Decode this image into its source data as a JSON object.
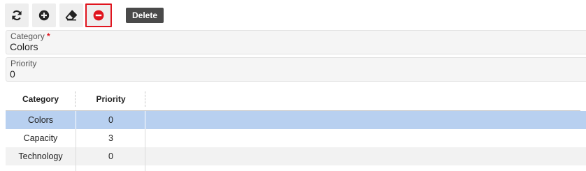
{
  "toolbar": {
    "buttons": [
      {
        "icon": "refresh-icon",
        "label": "Refresh"
      },
      {
        "icon": "add-circle-icon",
        "label": "Add"
      },
      {
        "icon": "eraser-icon",
        "label": "Clear"
      },
      {
        "icon": "remove-circle-icon",
        "label": "Delete"
      }
    ],
    "tooltip": "Delete",
    "delete_color": "#e0141e"
  },
  "form": {
    "category": {
      "label": "Category",
      "required_mark": "*",
      "value": "Colors"
    },
    "priority": {
      "label": "Priority",
      "value": "0"
    }
  },
  "grid": {
    "columns": [
      "Category",
      "Priority"
    ],
    "rows": [
      {
        "category": "Colors",
        "priority": "0",
        "selected": true
      },
      {
        "category": "Capacity",
        "priority": "3",
        "selected": false
      },
      {
        "category": "Technology",
        "priority": "0",
        "selected": false
      }
    ],
    "selected_color": "#b8d0f0"
  }
}
